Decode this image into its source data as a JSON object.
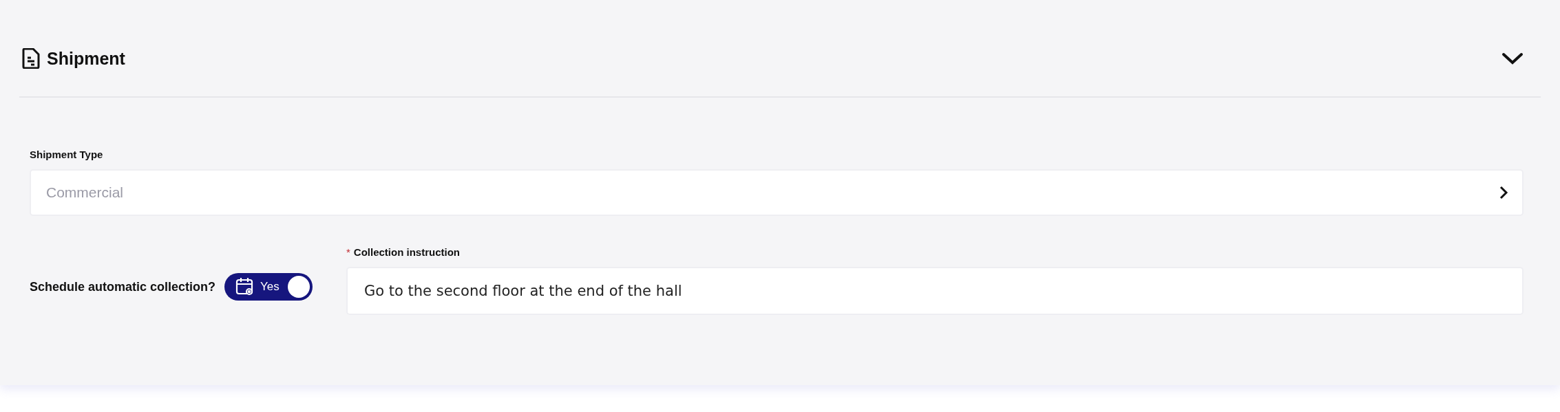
{
  "section": {
    "title": "Shipment",
    "expanded": true
  },
  "shipment_type": {
    "label": "Shipment Type",
    "placeholder": "Commercial"
  },
  "schedule": {
    "label": "Schedule automatic collection?",
    "on": true,
    "toggle_text": "Yes"
  },
  "collection_instruction": {
    "label": "Collection instruction",
    "required_mark": "*",
    "value": "Go to the second floor at the end of the hall"
  }
}
